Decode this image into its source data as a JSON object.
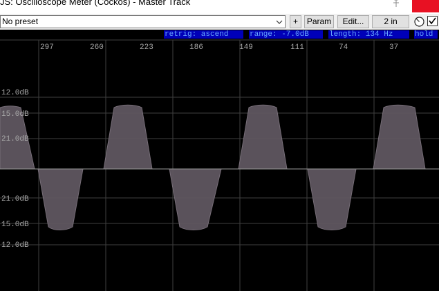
{
  "window": {
    "title": "JS: Oscilloscope Meter (Cockos) - Master Track"
  },
  "toolbar": {
    "preset_value": "No preset",
    "plus_label": "+",
    "param_label": "Param",
    "edit_label": "Edit...",
    "io_label": "2 in"
  },
  "status": {
    "retrig": "retrig: ascend",
    "range": "range: -7.0dB",
    "length": "length: 134 Hz",
    "hold": "hold"
  },
  "x_labels": [
    "297",
    "260",
    "223",
    "186",
    "149",
    "111",
    "74",
    "37"
  ],
  "db_labels": {
    "top": [
      "12.0dB",
      "15.0dB",
      "21.0dB"
    ],
    "bottom": [
      "21.0dB",
      "15.0dB",
      "12.0dB"
    ]
  },
  "colors": {
    "chip_bg": "#0000b8",
    "chip_text": "#66a6ff",
    "waveform_fill": "#5f5760",
    "grid": "#3f3f3f",
    "center_line": "#9a9a9a",
    "close_red": "#e81123"
  },
  "icons": {
    "pin": "pin-icon",
    "dropdown": "chevron-down-icon",
    "knob": "knob-icon",
    "checkbox": "checkbox-icon"
  }
}
